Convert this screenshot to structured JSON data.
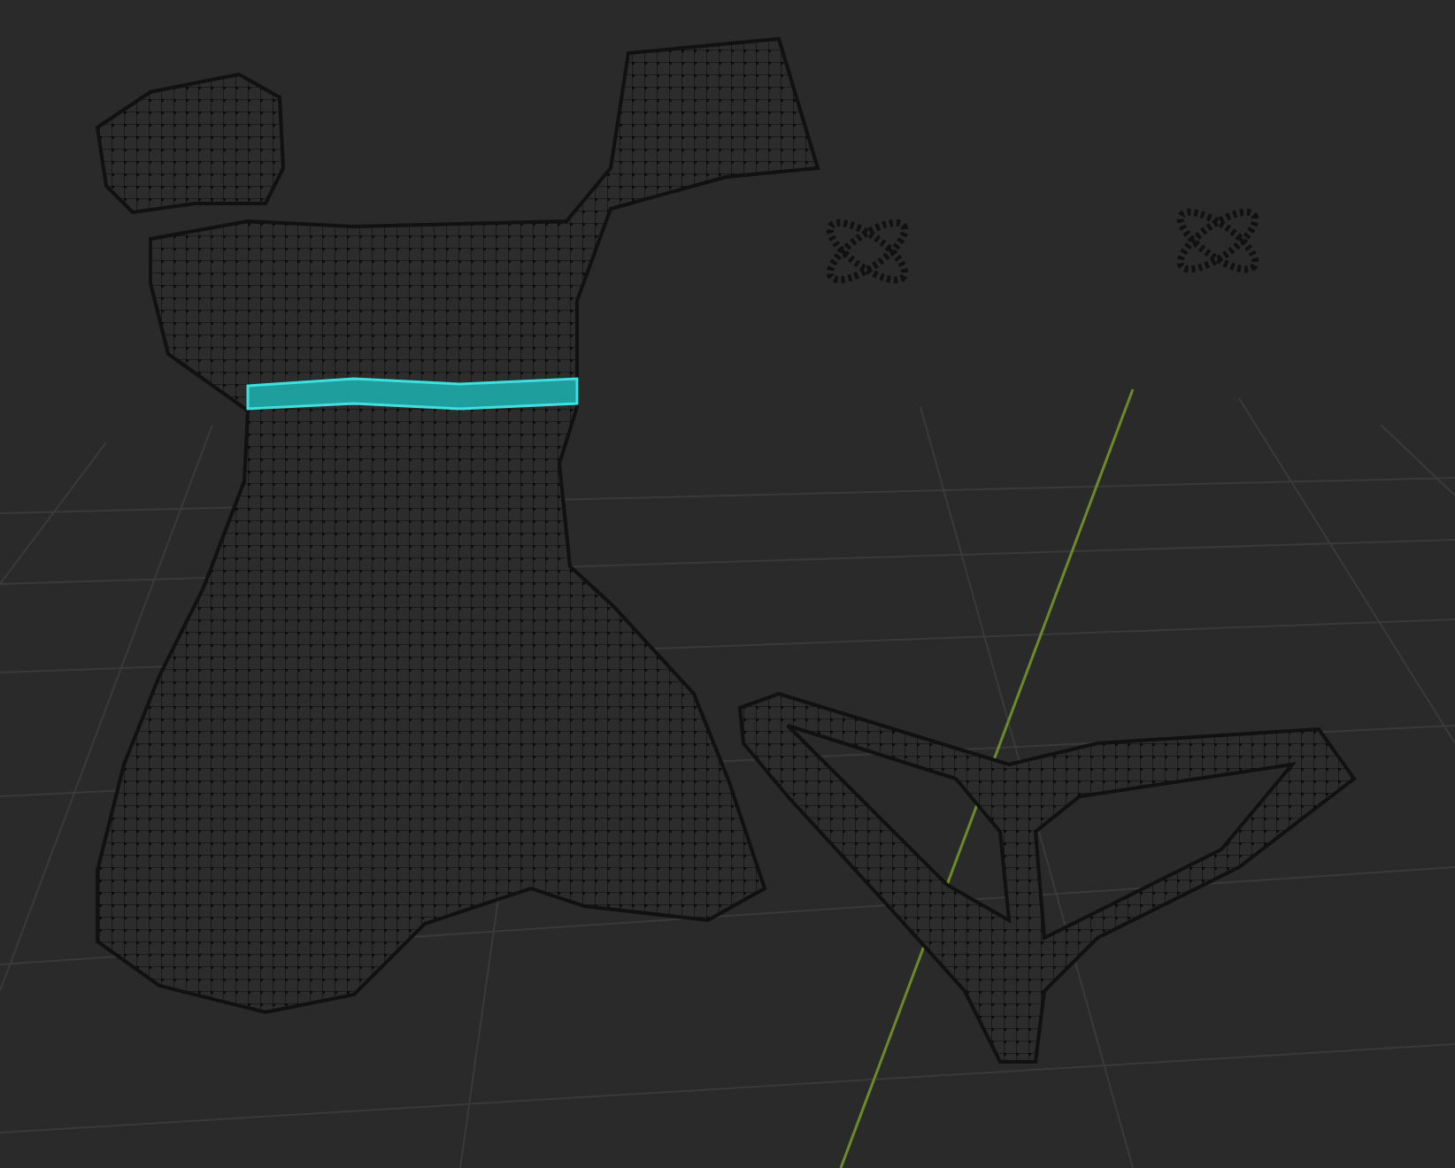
{
  "viewport": {
    "meshes": [
      {
        "kind": "dress"
      },
      {
        "kind": "sleeve"
      },
      {
        "kind": "thong"
      },
      {
        "kind": "ring"
      },
      {
        "kind": "ring"
      }
    ],
    "edge_selection": true
  }
}
